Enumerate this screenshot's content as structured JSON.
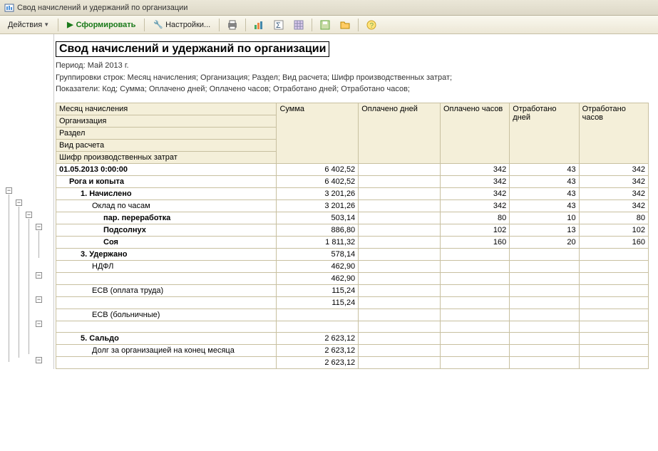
{
  "window": {
    "title": "Свод начислений и удержаний по организации"
  },
  "toolbar": {
    "actions": "Действия",
    "form": "Сформировать",
    "settings": "Настройки..."
  },
  "report": {
    "title": "Свод начислений и удержаний по организации",
    "period": "Период: Май 2013 г.",
    "grouping": "Группировки строк: Месяц начисления; Организация; Раздел; Вид расчета; Шифр производственных затрат;",
    "indicators": "Показатели: Код; Сумма; Оплачено дней; Оплачено часов; Отработано дней; Отработано часов;"
  },
  "headers": {
    "r1": "Месяц начисления",
    "r2": "Организация",
    "r3": "Раздел",
    "r4": "Вид расчета",
    "r5": "Шифр производственных затрат",
    "c1": "Сумма",
    "c2": "Оплачено дней",
    "c3": "Оплачено часов",
    "c4": "Отработано дней",
    "c5": "Отработано часов"
  },
  "rows": [
    {
      "label": "01.05.2013 0:00:00",
      "c1": "6 402,52",
      "c2": "",
      "c3": "342",
      "c4": "43",
      "c5": "342",
      "lvl": "lvl1"
    },
    {
      "label": "Рога и копыта",
      "c1": "6 402,52",
      "c2": "",
      "c3": "342",
      "c4": "43",
      "c5": "342",
      "lvl": "lvl2"
    },
    {
      "label": "1. Начислено",
      "c1": "3 201,26",
      "c2": "",
      "c3": "342",
      "c4": "43",
      "c5": "342",
      "lvl": "lvl3"
    },
    {
      "label": "Оклад по часам",
      "c1": "3 201,26",
      "c2": "",
      "c3": "342",
      "c4": "43",
      "c5": "342",
      "lvl": "lvl4"
    },
    {
      "label": "пар. переработка",
      "c1": "503,14",
      "c2": "",
      "c3": "80",
      "c4": "10",
      "c5": "80",
      "lvl": "lvl5"
    },
    {
      "label": "Подсолнух",
      "c1": "886,80",
      "c2": "",
      "c3": "102",
      "c4": "13",
      "c5": "102",
      "lvl": "lvl5"
    },
    {
      "label": "Соя",
      "c1": "1 811,32",
      "c2": "",
      "c3": "160",
      "c4": "20",
      "c5": "160",
      "lvl": "lvl5"
    },
    {
      "label": "3. Удержано",
      "c1": "578,14",
      "c2": "",
      "c3": "",
      "c4": "",
      "c5": "",
      "lvl": "lvl3"
    },
    {
      "label": "НДФЛ",
      "c1": "462,90",
      "c2": "",
      "c3": "",
      "c4": "",
      "c5": "",
      "lvl": "lvl4"
    },
    {
      "label": "",
      "c1": "462,90",
      "c2": "",
      "c3": "",
      "c4": "",
      "c5": "",
      "lvl": "lvl5n"
    },
    {
      "label": "ЕСВ (оплата труда)",
      "c1": "115,24",
      "c2": "",
      "c3": "",
      "c4": "",
      "c5": "",
      "lvl": "lvl4"
    },
    {
      "label": "",
      "c1": "115,24",
      "c2": "",
      "c3": "",
      "c4": "",
      "c5": "",
      "lvl": "lvl5n"
    },
    {
      "label": "ЕСВ (больничные)",
      "c1": "",
      "c2": "",
      "c3": "",
      "c4": "",
      "c5": "",
      "lvl": "lvl4"
    },
    {
      "label": "",
      "c1": "",
      "c2": "",
      "c3": "",
      "c4": "",
      "c5": "",
      "lvl": "lvl5n"
    },
    {
      "label": "5. Сальдо",
      "c1": "2 623,12",
      "c2": "",
      "c3": "",
      "c4": "",
      "c5": "",
      "lvl": "lvl3"
    },
    {
      "label": "Долг за организацией на конец месяца",
      "c1": "2 623,12",
      "c2": "",
      "c3": "",
      "c4": "",
      "c5": "",
      "lvl": "lvl4"
    },
    {
      "label": "",
      "c1": "2 623,12",
      "c2": "",
      "c3": "",
      "c4": "",
      "c5": "",
      "lvl": "lvl5n"
    }
  ]
}
